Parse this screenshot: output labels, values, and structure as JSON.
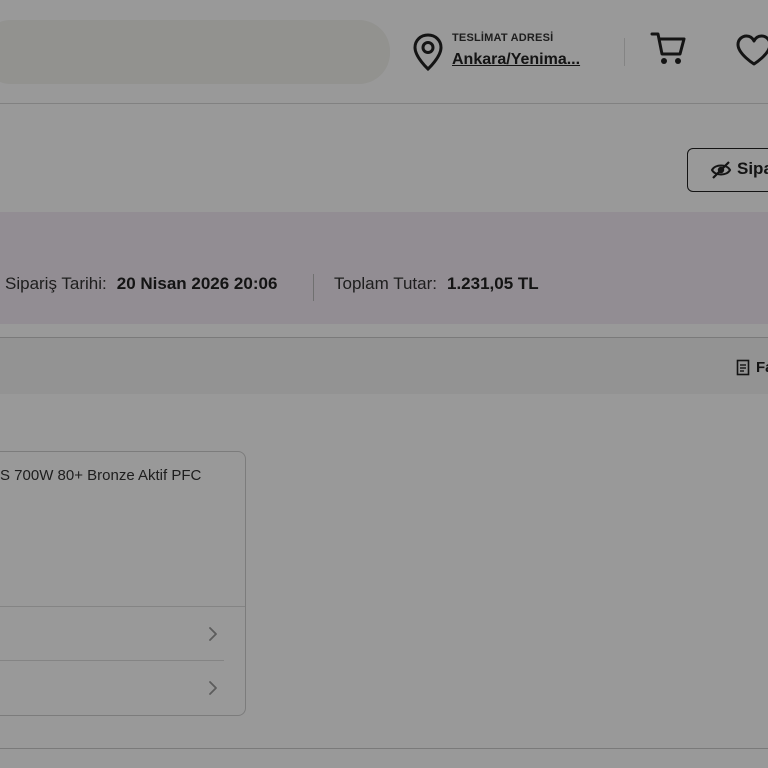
{
  "header": {
    "search_value": "",
    "location_small": "TESLİMAT ADRESİ",
    "location_big": "Ankara/Yenima...",
    "icons": [
      "location-pin-icon",
      "cart-icon",
      "heart-icon"
    ]
  },
  "actions": {
    "order_action_label": "Sipa",
    "order_action_icon": "eye-off-icon"
  },
  "order": {
    "date_label": "Sipariş Tarihi:",
    "date_value": "20 Nisan 2026 20:06",
    "total_label": "Toplam Tutar:",
    "total_value": "1.231,05 TL"
  },
  "invoice": {
    "label": "Fa",
    "icon": "document-icon"
  },
  "product": {
    "title": "S 700W 80+ Bronze Aktif PFC",
    "rows": [
      {
        "icon": "chevron-right-icon"
      },
      {
        "icon": "chevron-right-icon"
      }
    ]
  },
  "colors": {
    "band": "#f4ecf5",
    "sub_band": "#f5f5f5",
    "search_bg": "#f3f3ef",
    "overlay": "rgba(0,0,0,0.40)"
  }
}
